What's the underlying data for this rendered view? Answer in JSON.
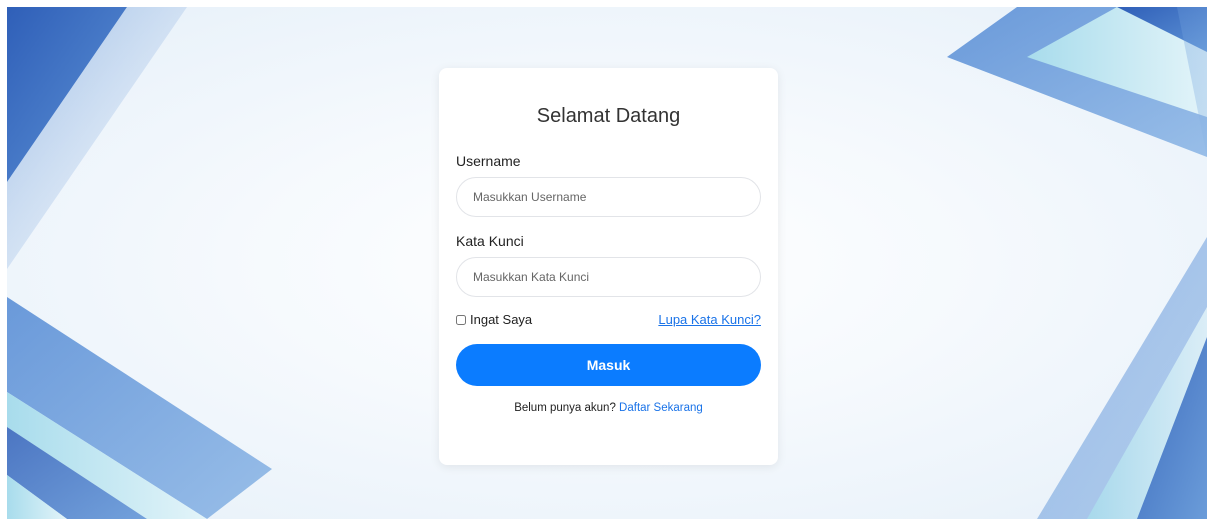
{
  "colors": {
    "accent": "#0b7cff",
    "link": "#1a73e8",
    "decor_dark_blue": "#3a6fc0",
    "decor_mid_blue": "#6c9fda",
    "decor_light_cyan": "#b5e4ee"
  },
  "login": {
    "title": "Selamat Datang",
    "username_label": "Username",
    "username_placeholder": "Masukkan Username",
    "username_value": "",
    "password_label": "Kata Kunci",
    "password_placeholder": "Masukkan Kata Kunci",
    "password_value": "",
    "remember_label": "Ingat Saya",
    "remember_checked": false,
    "forgot_link": "Lupa Kata Kunci?",
    "submit_label": "Masuk",
    "register_prompt": "Belum punya akun?",
    "register_link": "Daftar Sekarang"
  }
}
